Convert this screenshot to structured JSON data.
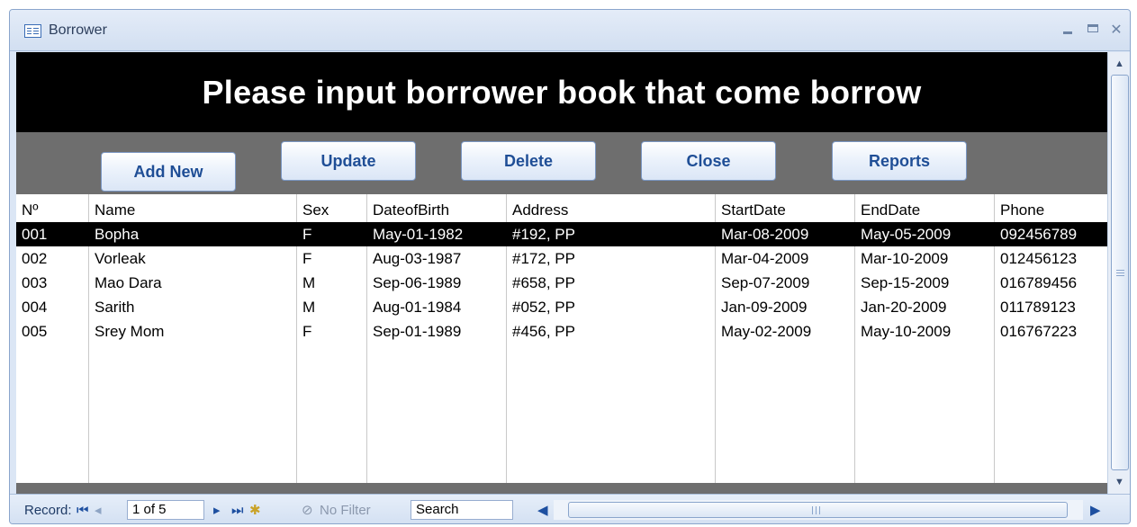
{
  "window": {
    "title": "Borrower"
  },
  "header": {
    "text": "Please input borrower book that come borrow"
  },
  "buttons": {
    "add_new": "Add New",
    "update": "Update",
    "delete": "Delete",
    "close": "Close",
    "reports": "Reports"
  },
  "table": {
    "columns": [
      "Nº",
      "Name",
      "Sex",
      "DateofBirth",
      "Address",
      "StartDate",
      "EndDate",
      "Phone"
    ],
    "selected_row": 0,
    "rows": [
      [
        "001",
        "Bopha",
        "F",
        "May-01-1982",
        "#192, PP",
        "Mar-08-2009",
        "May-05-2009",
        "092456789"
      ],
      [
        "002",
        "Vorleak",
        "F",
        "Aug-03-1987",
        "#172, PP",
        "Mar-04-2009",
        "Mar-10-2009",
        "012456123"
      ],
      [
        "003",
        "Mao Dara",
        "M",
        "Sep-06-1989",
        "#658, PP",
        "Sep-07-2009",
        "Sep-15-2009",
        "016789456"
      ],
      [
        "004",
        "Sarith",
        "M",
        "Aug-01-1984",
        "#052, PP",
        "Jan-09-2009",
        "Jan-20-2009",
        "011789123"
      ],
      [
        "005",
        "Srey Mom",
        "F",
        "Sep-01-1989",
        "#456, PP",
        "May-02-2009",
        "May-10-2009",
        "016767223"
      ]
    ]
  },
  "navigation": {
    "record_label": "Record:",
    "position": "1 of 5",
    "filter_label": "No Filter",
    "search_label": "Search"
  },
  "icons": {
    "first": "first-record-icon",
    "prev": "previous-record-icon",
    "next": "next-record-icon",
    "last": "last-record-icon",
    "new": "new-record-icon",
    "filter": "filter-icon"
  },
  "colors": {
    "header_bg": "#000000",
    "button_band_bg": "#6e6e6e",
    "button_text": "#1f4e96",
    "selected_row_bg": "#000000"
  }
}
